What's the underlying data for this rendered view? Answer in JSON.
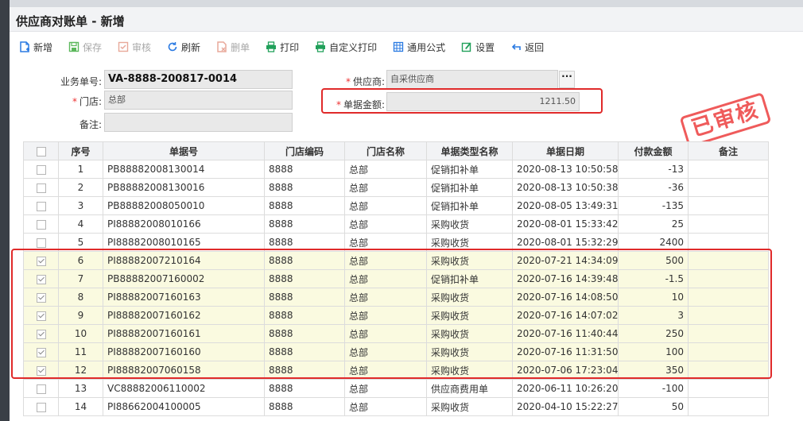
{
  "title": "供应商对账单 - 新增",
  "toolbar": [
    {
      "label": "新增",
      "icon": "new-doc-icon",
      "enabled": true
    },
    {
      "label": "保存",
      "icon": "save-icon",
      "enabled": false
    },
    {
      "label": "审核",
      "icon": "approve-icon",
      "enabled": false
    },
    {
      "label": "刷新",
      "icon": "refresh-icon",
      "enabled": true
    },
    {
      "label": "删单",
      "icon": "delete-doc-icon",
      "enabled": false
    },
    {
      "label": "打印",
      "icon": "print-icon",
      "enabled": true
    },
    {
      "label": "自定义打印",
      "icon": "custom-print-icon",
      "enabled": true
    },
    {
      "label": "通用公式",
      "icon": "formula-icon",
      "enabled": true
    },
    {
      "label": "设置",
      "icon": "settings-icon",
      "enabled": true
    },
    {
      "label": "返回",
      "icon": "back-icon",
      "enabled": true
    }
  ],
  "form": {
    "doc_no_label": "业务单号:",
    "doc_no": "VA-8888-200817-0014",
    "store_label": "门店:",
    "store": "总部",
    "remark_label": "备注:",
    "remark": "",
    "supplier_label": "供应商:",
    "supplier": "自采供应商",
    "amount_label": "单据金额:",
    "amount": "1211.50",
    "more_button": "···"
  },
  "stamp": "已审核",
  "table": {
    "headers": [
      "序号",
      "单据号",
      "门店编码",
      "门店名称",
      "单据类型名称",
      "单据日期",
      "付款金额",
      "备注"
    ],
    "rows": [
      {
        "checked": false,
        "seq": "1",
        "doc": "PB88882008130014",
        "store_code": "8888",
        "store_name": "总部",
        "type": "促销扣补单",
        "date": "2020-08-13 10:50:58",
        "amount": "-13",
        "remark": ""
      },
      {
        "checked": false,
        "seq": "2",
        "doc": "PB88882008130016",
        "store_code": "8888",
        "store_name": "总部",
        "type": "促销扣补单",
        "date": "2020-08-13 10:50:38",
        "amount": "-36",
        "remark": ""
      },
      {
        "checked": false,
        "seq": "3",
        "doc": "PB88882008050010",
        "store_code": "8888",
        "store_name": "总部",
        "type": "促销扣补单",
        "date": "2020-08-05 13:49:31",
        "amount": "-135",
        "remark": ""
      },
      {
        "checked": false,
        "seq": "4",
        "doc": "PI88882008010166",
        "store_code": "8888",
        "store_name": "总部",
        "type": "采购收货",
        "date": "2020-08-01 15:33:42",
        "amount": "25",
        "remark": ""
      },
      {
        "checked": false,
        "seq": "5",
        "doc": "PI88882008010165",
        "store_code": "8888",
        "store_name": "总部",
        "type": "采购收货",
        "date": "2020-08-01 15:32:29",
        "amount": "2400",
        "remark": ""
      },
      {
        "checked": true,
        "seq": "6",
        "doc": "PI88882007210164",
        "store_code": "8888",
        "store_name": "总部",
        "type": "采购收货",
        "date": "2020-07-21 14:34:09",
        "amount": "500",
        "remark": ""
      },
      {
        "checked": true,
        "seq": "7",
        "doc": "PB88882007160002",
        "store_code": "8888",
        "store_name": "总部",
        "type": "促销扣补单",
        "date": "2020-07-16 14:39:48",
        "amount": "-1.5",
        "remark": ""
      },
      {
        "checked": true,
        "seq": "8",
        "doc": "PI88882007160163",
        "store_code": "8888",
        "store_name": "总部",
        "type": "采购收货",
        "date": "2020-07-16 14:08:50",
        "amount": "10",
        "remark": ""
      },
      {
        "checked": true,
        "seq": "9",
        "doc": "PI88882007160162",
        "store_code": "8888",
        "store_name": "总部",
        "type": "采购收货",
        "date": "2020-07-16 14:07:02",
        "amount": "3",
        "remark": ""
      },
      {
        "checked": true,
        "seq": "10",
        "doc": "PI88882007160161",
        "store_code": "8888",
        "store_name": "总部",
        "type": "采购收货",
        "date": "2020-07-16 11:40:44",
        "amount": "250",
        "remark": ""
      },
      {
        "checked": true,
        "seq": "11",
        "doc": "PI88882007160160",
        "store_code": "8888",
        "store_name": "总部",
        "type": "采购收货",
        "date": "2020-07-16 11:31:50",
        "amount": "100",
        "remark": ""
      },
      {
        "checked": true,
        "seq": "12",
        "doc": "PI88882007060158",
        "store_code": "8888",
        "store_name": "总部",
        "type": "采购收货",
        "date": "2020-07-06 17:23:04",
        "amount": "350",
        "remark": ""
      },
      {
        "checked": false,
        "seq": "13",
        "doc": "VC88882006110002",
        "store_code": "8888",
        "store_name": "总部",
        "type": "供应商费用单",
        "date": "2020-06-11 10:26:20",
        "amount": "-100",
        "remark": ""
      },
      {
        "checked": false,
        "seq": "14",
        "doc": "PI88662004100005",
        "store_code": "8888",
        "store_name": "总部",
        "type": "采购收货",
        "date": "2020-04-10 15:22:27",
        "amount": "50",
        "remark": ""
      }
    ]
  },
  "colors": {
    "highlight": "#e02a2a",
    "selected_row": "#fafae0",
    "stamp": "#ee4a4a",
    "accent": "#2a7ae2",
    "print": "#21a05a"
  }
}
